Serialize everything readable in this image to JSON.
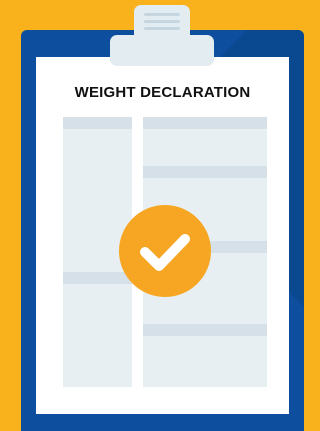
{
  "document": {
    "title": "WEIGHT DECLARATION"
  },
  "icons": {
    "badge": "checkmark-icon"
  },
  "colors": {
    "background": "#F9B21B",
    "board": "#0D4F9E",
    "paper": "#FFFFFF",
    "clip": "#E3ECF1",
    "accent": "#F6A623"
  }
}
